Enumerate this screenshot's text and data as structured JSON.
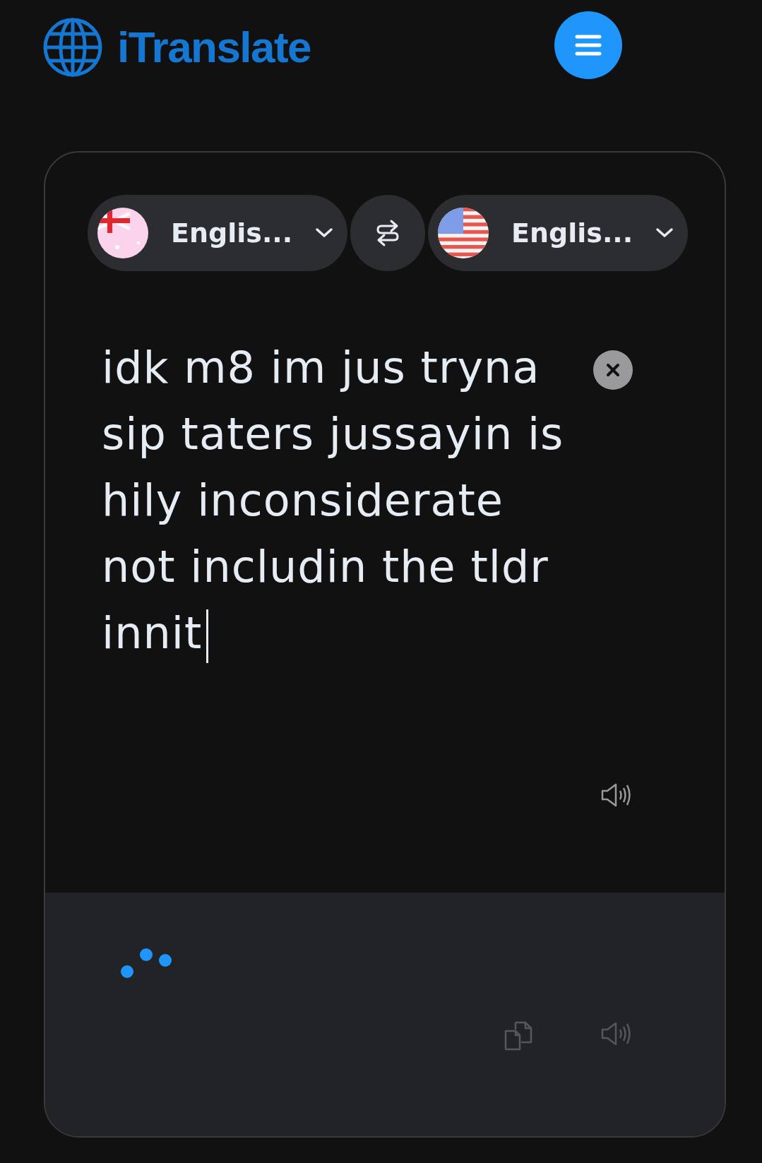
{
  "header": {
    "logo": "iTranslate"
  },
  "languages": {
    "source": {
      "label": "Englis...",
      "kind": "australia"
    },
    "target": {
      "label": "Englis...",
      "kind": "usa"
    }
  },
  "input": {
    "value": "idk m8 im jus tryna sip taters jussayin is hily inconsiderate not includin the tldr innit",
    "focused": true
  },
  "output": {
    "loading": true
  }
}
